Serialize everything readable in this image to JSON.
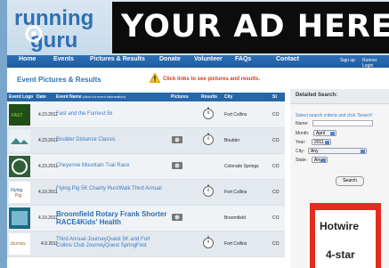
{
  "site": {
    "logo_text": "running guru",
    "ad_text": "YOUR AD HERE"
  },
  "nav": {
    "items": [
      "Home",
      "Events",
      "Pictures & Results",
      "Donate",
      "Volunteer",
      "FAQs",
      "Contact"
    ],
    "right_links": [
      "Sign up",
      "Runner Login"
    ]
  },
  "page": {
    "title": "Event Pictures & Results",
    "notice": "Click links to see pictures and results."
  },
  "table": {
    "headers": [
      "Event Logo",
      "Date",
      "Event Name",
      "Pictures",
      "Results",
      "City",
      "St"
    ],
    "event_name_hint": "(click for event information)",
    "rows": [
      {
        "date": "4.23.2011",
        "event": "Fast and the Furriest 5k",
        "pictures": false,
        "results": true,
        "city": "Fort Collins",
        "state": "CO"
      },
      {
        "date": "4.23.2011",
        "event": "Boulder Distance Classic",
        "pictures": true,
        "results": true,
        "city": "Boulder",
        "state": "CO"
      },
      {
        "date": "4.23.2011",
        "event": "Cheyenne Mountain Trail Race",
        "pictures": true,
        "results": false,
        "city": "Colorado Springs",
        "state": "CO"
      },
      {
        "date": "4.10.2011",
        "event": "Flying Pig 5K Charity Run/Walk Third Annual",
        "pictures": false,
        "results": true,
        "city": "Fort Collins",
        "state": "CO"
      },
      {
        "date": "4.10.2011",
        "event": "Broomfield Rotary Frank Shorter RACE4Kids' Health",
        "pictures": true,
        "results": false,
        "city": "Broomfield",
        "state": "CO"
      },
      {
        "date": "4.9.2011",
        "event": "Third Annual JourneyQuest 5K and Fort Collins Club JourneyQuest SpringFest",
        "pictures": false,
        "results": true,
        "city": "Fort Collins",
        "state": "CO"
      }
    ]
  },
  "search": {
    "title": "Detailed Search:",
    "instructions": "Select search criteria and click 'Search'",
    "name_label": "Name:",
    "month_label": "Month:",
    "month_value": "April",
    "year_label": "Year:",
    "year_value": "2011",
    "city_label": "City:",
    "city_value": "Any",
    "state_label": "State:",
    "state_value": "Any",
    "button": "Search"
  },
  "ad_side": {
    "brand": "Hotwire",
    "tagline": "4-star"
  },
  "colors": {
    "nav": "#1f5ea3",
    "title": "#2f74b4",
    "ad_red": "#e52b1f",
    "warning": "#d83a1b"
  }
}
